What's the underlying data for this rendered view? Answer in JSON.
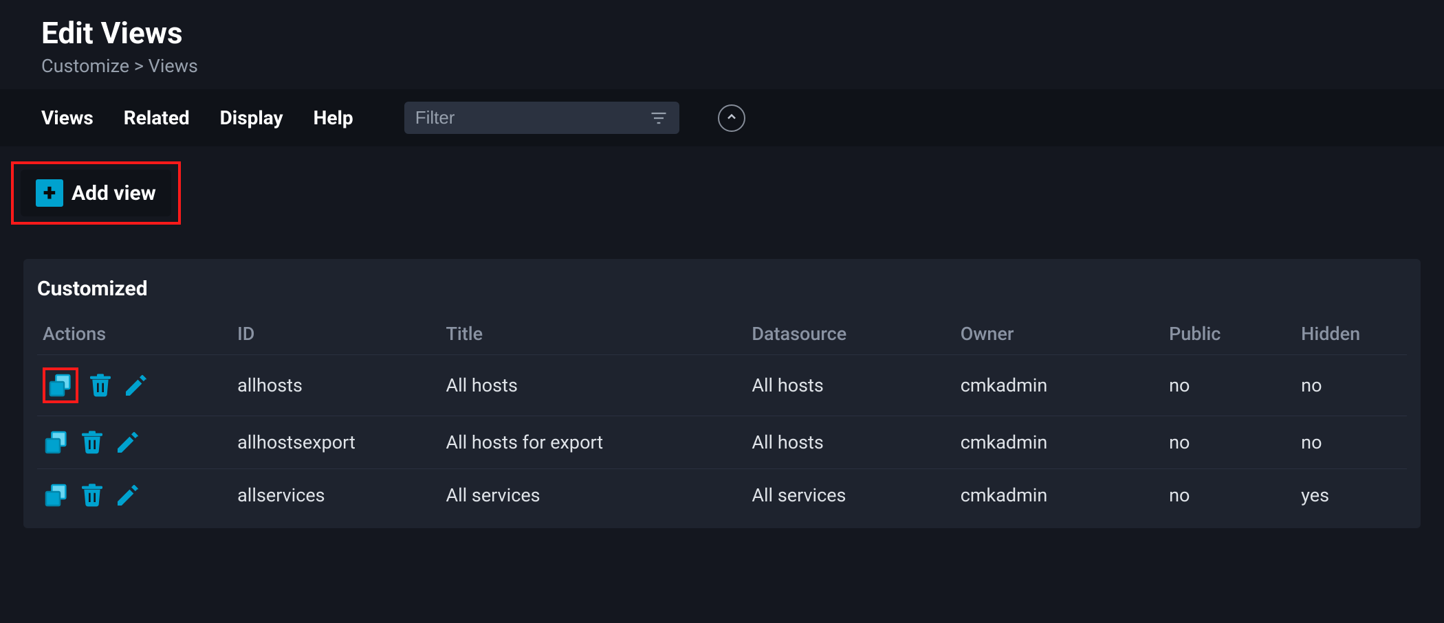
{
  "header": {
    "title": "Edit Views",
    "breadcrumb_parent": "Customize",
    "breadcrumb_sep": ">",
    "breadcrumb_current": "Views"
  },
  "menubar": {
    "views": "Views",
    "related": "Related",
    "display": "Display",
    "help": "Help",
    "filter_placeholder": "Filter"
  },
  "actions": {
    "add_view_label": "Add view"
  },
  "section": {
    "title": "Customized"
  },
  "table": {
    "headers": {
      "actions": "Actions",
      "id": "ID",
      "title": "Title",
      "datasource": "Datasource",
      "owner": "Owner",
      "public": "Public",
      "hidden": "Hidden"
    },
    "rows": [
      {
        "id": "allhosts",
        "title": "All hosts",
        "datasource": "All hosts",
        "owner": "cmkadmin",
        "public": "no",
        "hidden": "no",
        "clone_hl": true
      },
      {
        "id": "allhostsexport",
        "title": "All hosts for export",
        "datasource": "All hosts",
        "owner": "cmkadmin",
        "public": "no",
        "hidden": "no",
        "clone_hl": false
      },
      {
        "id": "allservices",
        "title": "All services",
        "datasource": "All services",
        "owner": "cmkadmin",
        "public": "no",
        "hidden": "yes",
        "clone_hl": false
      }
    ]
  },
  "icons": {
    "clone": "clone-icon",
    "delete": "trash-icon",
    "edit": "pencil-icon",
    "filter": "filter-icon",
    "collapse": "chevron-up-icon",
    "plus": "plus-icon"
  }
}
